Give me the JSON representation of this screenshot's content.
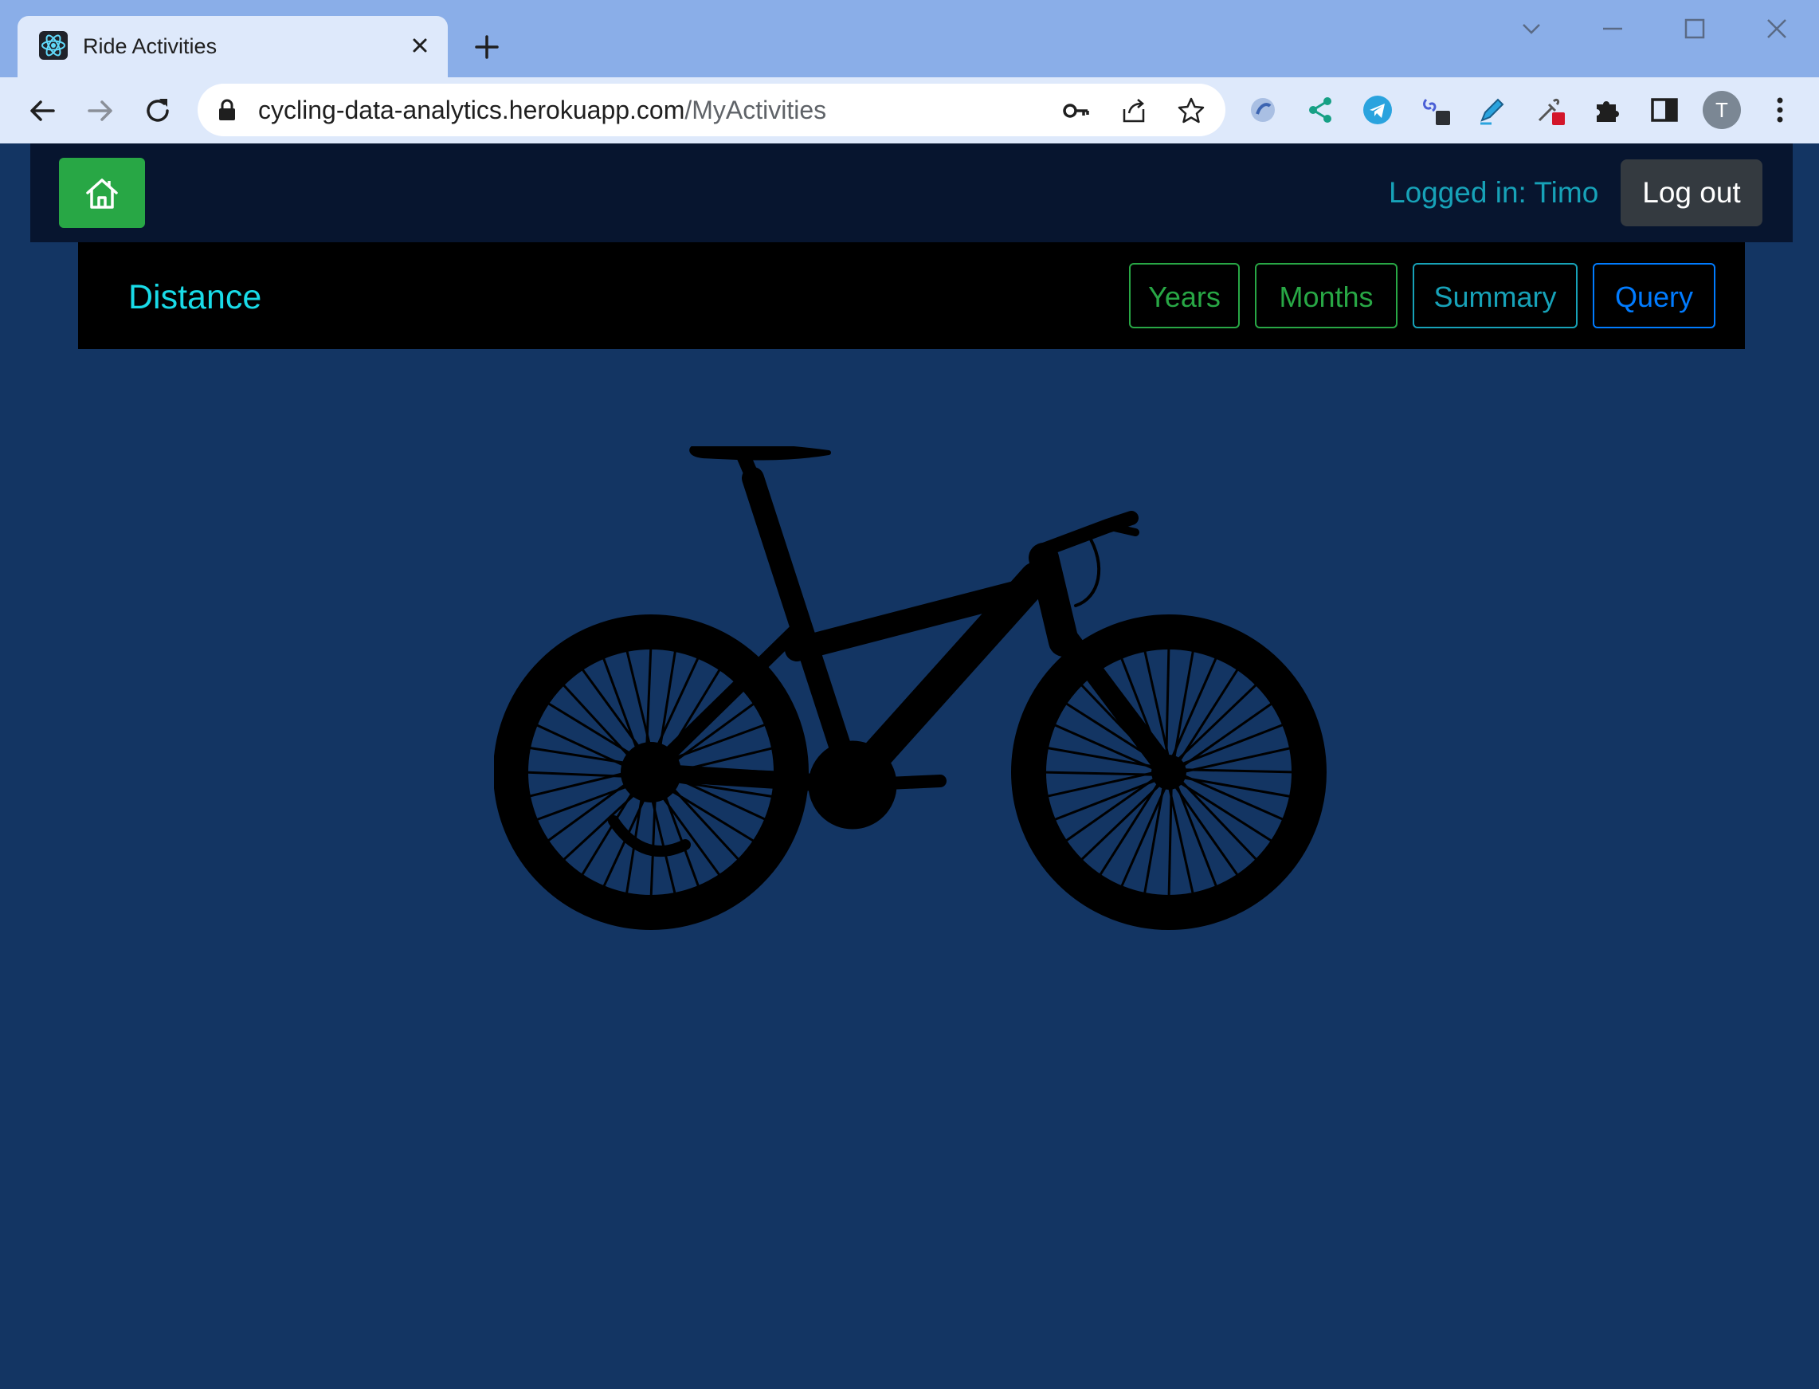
{
  "browser": {
    "tab_title": "Ride Activities",
    "url_host": "cycling-data-analytics.herokuapp.com",
    "url_path": "/MyActivities",
    "profile_initial": "T",
    "icons": [
      "react-favicon",
      "close-icon",
      "plus-icon",
      "back-icon",
      "forward-icon",
      "reload-icon",
      "lock-icon",
      "key-icon",
      "share-icon",
      "star-icon",
      "puzzle-icon",
      "sidepanel-icon",
      "menu-icon"
    ]
  },
  "header": {
    "logged_in_text": "Logged in: Timo",
    "logout_label": "Log out"
  },
  "subnav": {
    "title": "Distance",
    "items": [
      {
        "label": "Years"
      },
      {
        "label": "Months"
      },
      {
        "label": "Summary"
      },
      {
        "label": "Query"
      }
    ]
  },
  "colors": {
    "page_background": "#133563",
    "top_nav": "#07152f",
    "success": "#28a745",
    "info": "#17a2b8",
    "primary": "#007bff",
    "title_cyan": "#19dbe8"
  }
}
